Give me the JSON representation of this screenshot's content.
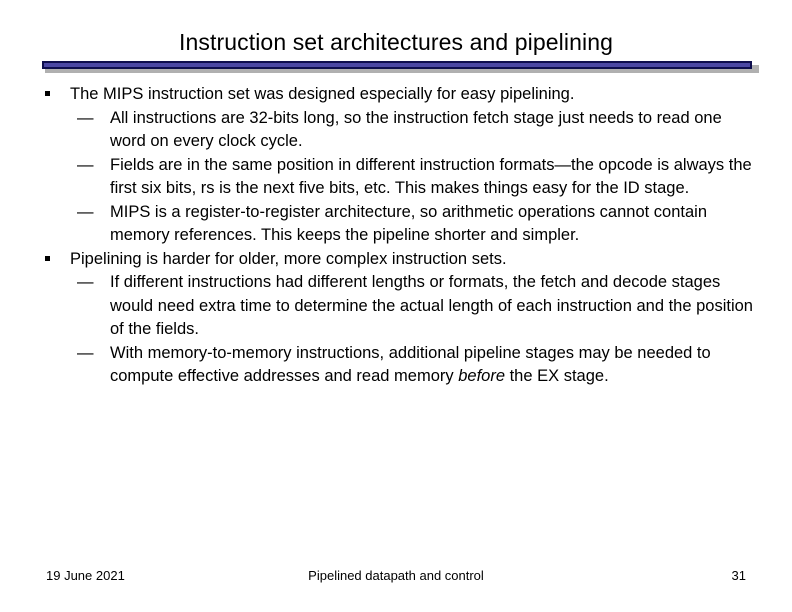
{
  "slide": {
    "title": "Instruction set architectures and pipelining",
    "bullet_glyph_level1": "square-bullet",
    "bullet_glyph_level2": "—",
    "rule_fill_color": "#4a47a3",
    "rule_border_color": "#0d0d4d",
    "rule_shadow_color": "#b0b0b0",
    "body": [
      {
        "text": "The MIPS instruction set was designed especially for easy pipelining.",
        "children": [
          {
            "text": "All instructions are 32-bits long, so the instruction fetch stage just needs to read one word on every clock cycle."
          },
          {
            "text": "Fields are in the same position in different instruction formats—the opcode is always the first six bits, rs is the next five bits, etc. This makes things easy for the ID stage."
          },
          {
            "text": "MIPS is a register-to-register architecture, so arithmetic operations cannot contain memory references. This keeps the pipeline shorter and simpler."
          }
        ]
      },
      {
        "text": "Pipelining is harder for older, more complex instruction sets.",
        "children": [
          {
            "text": "If different instructions had different lengths or formats, the fetch and decode stages would need extra time to determine the actual length of each instruction and the position of the fields."
          },
          {
            "segments": [
              {
                "text": "With memory-to-memory instructions, additional pipeline stages may be needed to compute effective addresses and read memory ",
                "italic": false
              },
              {
                "text": "before",
                "italic": true
              },
              {
                "text": " the EX stage.",
                "italic": false
              }
            ]
          }
        ]
      }
    ]
  },
  "footer": {
    "date": "19 June 2021",
    "center": "Pipelined datapath and control",
    "page_number": "31"
  }
}
